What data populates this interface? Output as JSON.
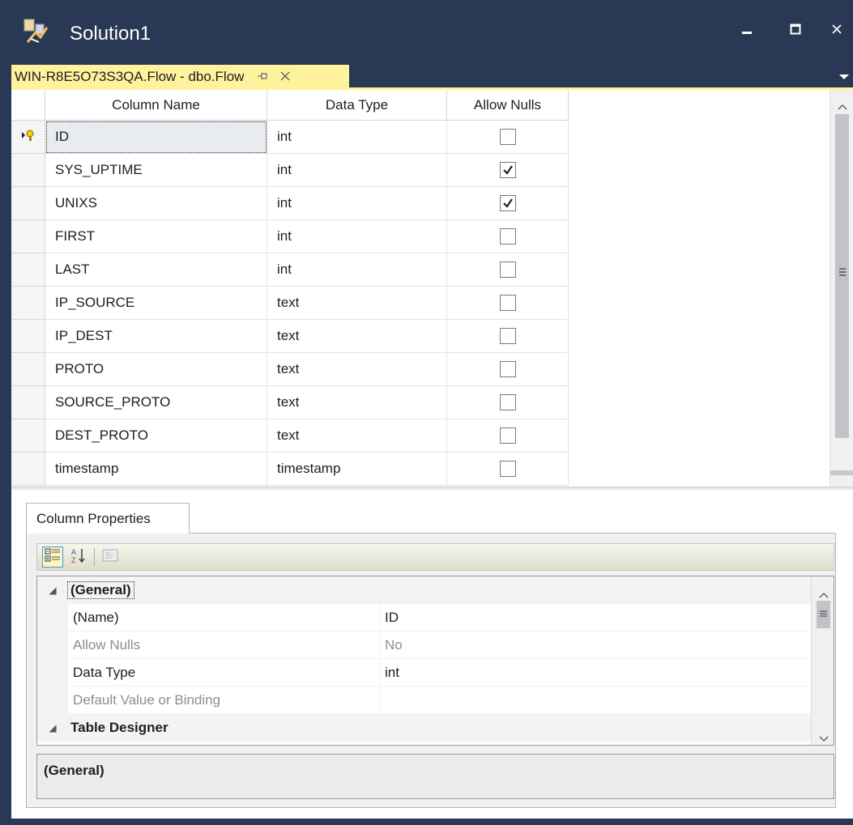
{
  "window": {
    "title": "Solution1",
    "icon": "solution-icon",
    "controls": [
      "minimize-icon",
      "maximize-icon",
      "close-icon"
    ]
  },
  "doc_tab": {
    "label": "WIN-R8E5O73S3QA.Flow - dbo.Flow",
    "pin_icon": "pin-icon",
    "close_icon": "close-icon"
  },
  "grid": {
    "headers": [
      "Column Name",
      "Data Type",
      "Allow Nulls"
    ],
    "rows": [
      {
        "name": "ID",
        "type": "int",
        "allow_nulls": false,
        "primary_key": true
      },
      {
        "name": "SYS_UPTIME",
        "type": "int",
        "allow_nulls": true
      },
      {
        "name": "UNIXS",
        "type": "int",
        "allow_nulls": true
      },
      {
        "name": "FIRST",
        "type": "int",
        "allow_nulls": false
      },
      {
        "name": "LAST",
        "type": "int",
        "allow_nulls": false
      },
      {
        "name": "IP_SOURCE",
        "type": "text",
        "allow_nulls": false
      },
      {
        "name": "IP_DEST",
        "type": "text",
        "allow_nulls": false
      },
      {
        "name": "PROTO",
        "type": "text",
        "allow_nulls": false
      },
      {
        "name": "SOURCE_PROTO",
        "type": "text",
        "allow_nulls": false
      },
      {
        "name": "DEST_PROTO",
        "type": "text",
        "allow_nulls": false
      },
      {
        "name": "timestamp",
        "type": "timestamp",
        "allow_nulls": false
      }
    ]
  },
  "properties": {
    "tab_label": "Column Properties",
    "toolbar": [
      "categorized-icon",
      "alphabetical-icon",
      "property-pages-icon"
    ],
    "categories": [
      {
        "label": "(General)",
        "items": [
          {
            "name": "(Name)",
            "value": "ID",
            "disabled": false
          },
          {
            "name": "Allow Nulls",
            "value": "No",
            "disabled": true
          },
          {
            "name": "Data Type",
            "value": "int",
            "disabled": false
          },
          {
            "name": "Default Value or Binding",
            "value": "",
            "disabled": true
          }
        ]
      },
      {
        "label": "Table Designer",
        "items": []
      }
    ],
    "description": "(General)"
  },
  "colors": {
    "chrome": "#293955",
    "active_tab": "#fff29d"
  }
}
